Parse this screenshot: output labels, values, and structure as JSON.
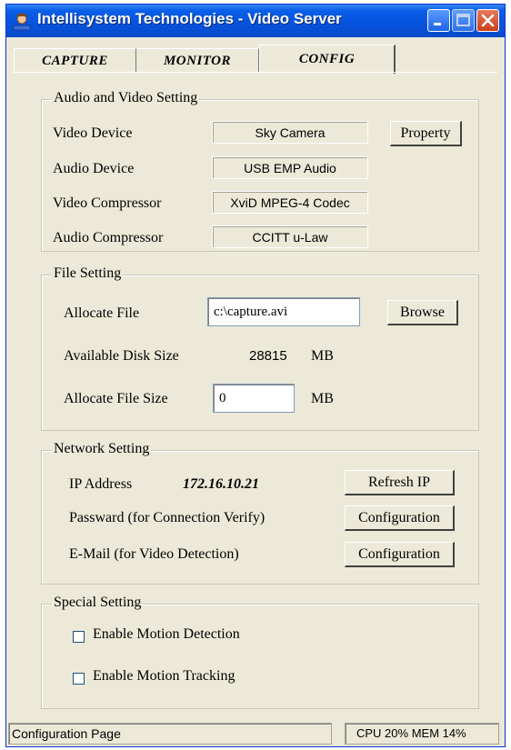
{
  "window": {
    "title": "Intellisystem Technologies - Video Server",
    "colors": {
      "titlebar": "#0652dd",
      "face": "#ece9d8",
      "close": "#c8401c"
    }
  },
  "tabs": [
    {
      "label": "CAPTURE",
      "active": false
    },
    {
      "label": "MONITOR",
      "active": false
    },
    {
      "label": "CONFIG",
      "active": true
    }
  ],
  "audio_video": {
    "legend": "Audio and Video Setting",
    "video_device_label": "Video Device",
    "video_device_value": "Sky Camera",
    "property_button": "Property",
    "audio_device_label": "Audio Device",
    "audio_device_value": "USB EMP Audio",
    "video_compressor_label": "Video Compressor",
    "video_compressor_value": "XviD MPEG-4 Codec",
    "audio_compressor_label": "Audio Compressor",
    "audio_compressor_value": "CCITT u-Law"
  },
  "file_setting": {
    "legend": "File Setting",
    "allocate_file_label": "Allocate File",
    "allocate_file_value": "c:\\capture.avi",
    "browse_button": "Browse",
    "disk_size_label": "Available Disk Size",
    "disk_size_value": "28815",
    "disk_size_unit": "MB",
    "file_size_label": "Allocate File Size",
    "file_size_value": "0",
    "file_size_unit": "MB"
  },
  "network": {
    "legend": "Network Setting",
    "ip_label": "IP Address",
    "ip_value": "172.16.10.21",
    "refresh_button": "Refresh IP",
    "password_label": "Passward (for Connection Verify)",
    "password_button": "Configuration",
    "email_label": "E-Mail (for Video Detection)",
    "email_button": "Configuration"
  },
  "special": {
    "legend": "Special Setting",
    "motion_detection_label": "Enable Motion Detection",
    "motion_detection_checked": false,
    "motion_tracking_label": "Enable Motion Tracking",
    "motion_tracking_checked": false
  },
  "status": {
    "page": "Configuration Page",
    "usage": "CPU 20% MEM 14%"
  }
}
